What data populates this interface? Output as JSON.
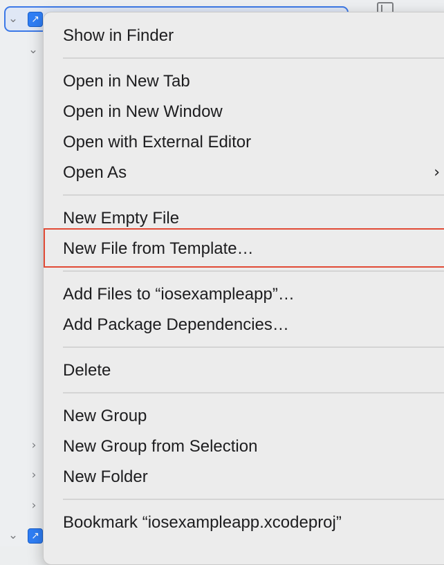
{
  "menu": {
    "items": [
      {
        "label": "Show in Finder"
      },
      {
        "label": "Open in New Tab"
      },
      {
        "label": "Open in New Window"
      },
      {
        "label": "Open with External Editor"
      },
      {
        "label": "Open As",
        "has_submenu": true
      },
      {
        "label": "New Empty File"
      },
      {
        "label": "New File from Template…",
        "highlighted": true
      },
      {
        "label": "Add Files to “iosexampleapp”…"
      },
      {
        "label": "Add Package Dependencies…"
      },
      {
        "label": "Delete"
      },
      {
        "label": "New Group"
      },
      {
        "label": "New Group from Selection"
      },
      {
        "label": "New Folder"
      },
      {
        "label": "Bookmark “iosexampleapp.xcodeproj”"
      }
    ]
  },
  "icons": {
    "submenu": "chevron-right-icon",
    "disclosure_open": "chevron-down-icon",
    "disclosure_closed": "chevron-right-icon",
    "project": "xcode-project-icon",
    "inspector": "sidebar-toggle-icon"
  },
  "colors": {
    "highlight_border": "#e14a35",
    "selection_border": "#3b78e7",
    "menu_background": "#ececec",
    "text": "#1d1d1f"
  }
}
